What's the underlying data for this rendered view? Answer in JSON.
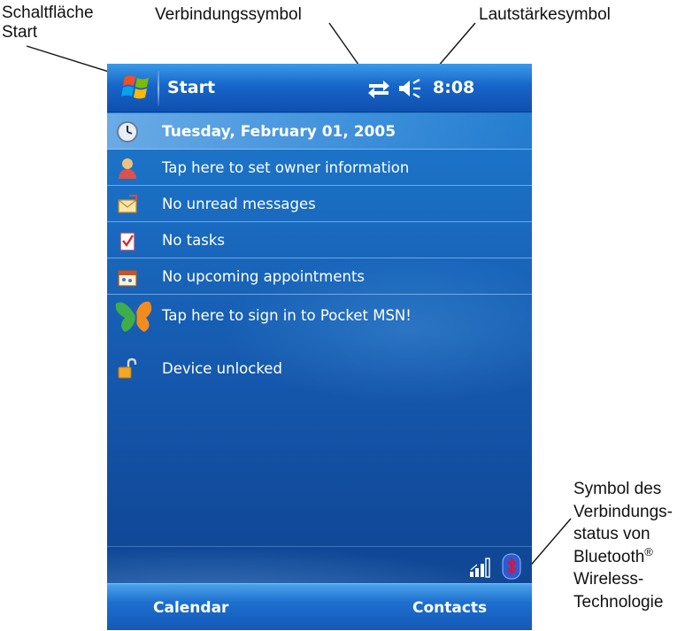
{
  "callouts": {
    "start_button": [
      "Schaltfläche",
      "Start"
    ],
    "connectivity": "Verbindungssymbol",
    "volume": "Lautstärkesymbol",
    "bluetooth": {
      "lines": [
        "Symbol des",
        "Verbindungs-",
        "status von"
      ],
      "brand": "Bluetooth",
      "registered_mark": "®",
      "tail": [
        "Wireless-",
        "Technologie"
      ]
    }
  },
  "device": {
    "title_bar": {
      "start_label": "Start",
      "time": "8:08",
      "icons": [
        "windows-flag-icon",
        "connectivity-icon",
        "volume-icon"
      ]
    },
    "today_items": [
      {
        "icon": "clock-icon",
        "label": "Tuesday, February 01, 2005"
      },
      {
        "icon": "owner-icon",
        "label": "Tap here to set owner information"
      },
      {
        "icon": "messages-icon",
        "label": "No unread messages"
      },
      {
        "icon": "tasks-icon",
        "label": "No tasks"
      },
      {
        "icon": "calendar-icon",
        "label": "No upcoming appointments"
      },
      {
        "icon": "msn-butterfly-icon",
        "label": "Tap here to sign in to Pocket MSN!"
      },
      {
        "icon": "padlock-icon",
        "label": "Device unlocked"
      }
    ],
    "status_icons": [
      "signal-strength-icon",
      "bluetooth-icon"
    ],
    "soft_keys": {
      "left": "Calendar",
      "right": "Contacts"
    }
  },
  "colors": {
    "background_top": "#1f7fd0",
    "background_bottom": "#0f4590",
    "title_bar": "#1766c9",
    "text": "#ffffff"
  }
}
